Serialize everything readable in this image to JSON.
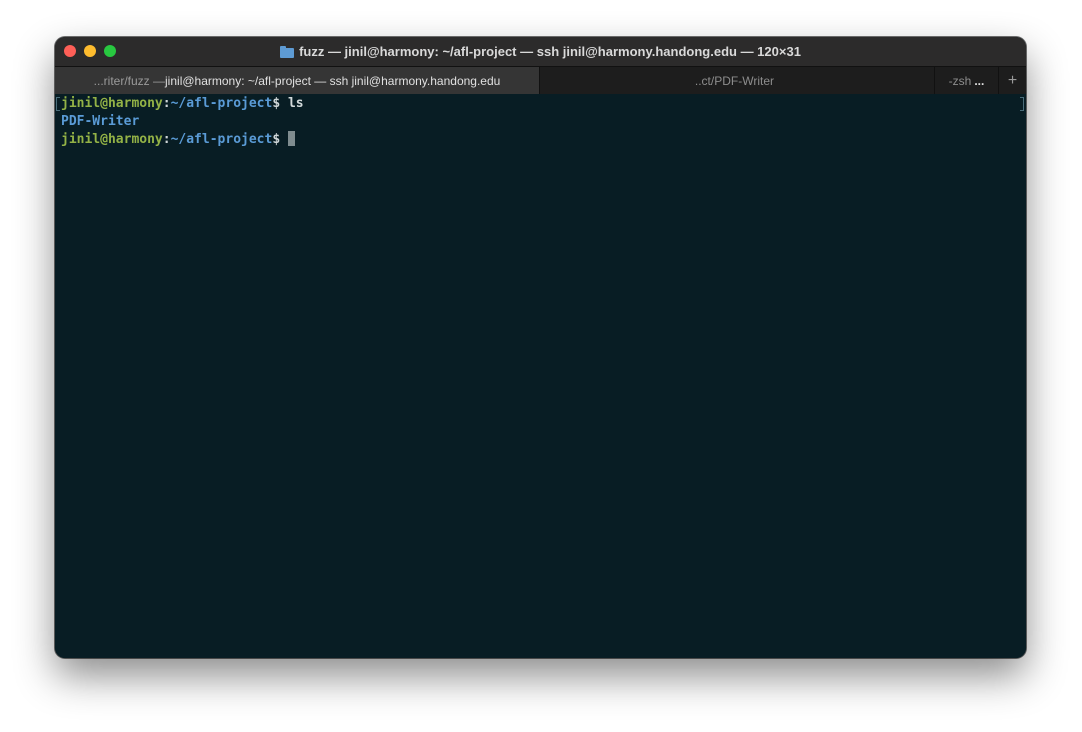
{
  "window": {
    "title": "fuzz — jinil@harmony: ~/afl-project — ssh jinil@harmony.handong.edu — 120×31",
    "title_icon": "folder-icon"
  },
  "tabs": [
    {
      "prefix": "...riter/fuzz — ",
      "label": "jinil@harmony: ~/afl-project — ssh jinil@harmony.handong.edu",
      "active": true
    },
    {
      "label": "..ct/PDF-Writer",
      "active": false
    },
    {
      "label": "-zsh",
      "overflow": "...",
      "active": false
    }
  ],
  "new_tab_label": "+",
  "terminal": {
    "lines": [
      {
        "user": "jinil@harmony",
        "colon": ":",
        "path": "~/afl-project",
        "dollar": "$ ",
        "cmd": "ls"
      },
      {
        "output": "PDF-Writer"
      },
      {
        "user": "jinil@harmony",
        "colon": ":",
        "path": "~/afl-project",
        "dollar": "$ ",
        "cmd": ""
      }
    ]
  },
  "colors": {
    "terminal_bg": "#081d24",
    "user": "#93b246",
    "path": "#5a9bd6",
    "titlebar": "#2c2b2b"
  }
}
